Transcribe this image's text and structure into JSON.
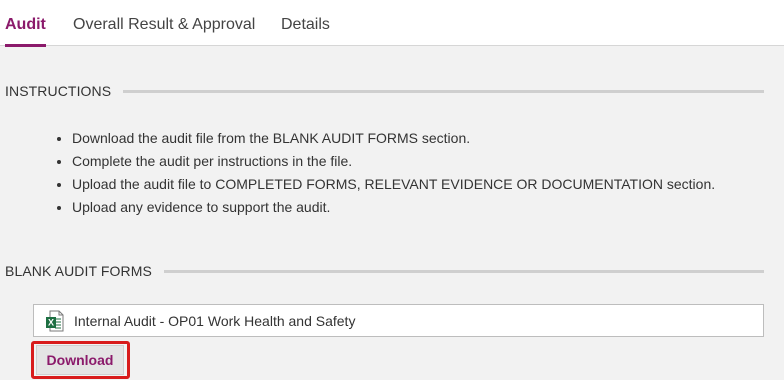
{
  "tabs": [
    {
      "label": "Audit",
      "active": true
    },
    {
      "label": "Overall Result & Approval",
      "active": false
    },
    {
      "label": "Details",
      "active": false
    }
  ],
  "instructions": {
    "title": "INSTRUCTIONS",
    "items": [
      "Download the audit file from the BLANK AUDIT FORMS section.",
      "Complete the audit per instructions in the file.",
      "Upload the audit file to COMPLETED FORMS, RELEVANT EVIDENCE OR DOCUMENTATION section.",
      "Upload any evidence to support the audit."
    ]
  },
  "blank_forms": {
    "title": "BLANK AUDIT FORMS",
    "file_icon": "excel-file-icon",
    "file_name": "Internal Audit - OP01 Work Health and Safety",
    "download_label": "Download"
  },
  "colors": {
    "accent": "#8b1a6b",
    "highlight": "#d81b1b",
    "excel": "#1d6f42"
  }
}
